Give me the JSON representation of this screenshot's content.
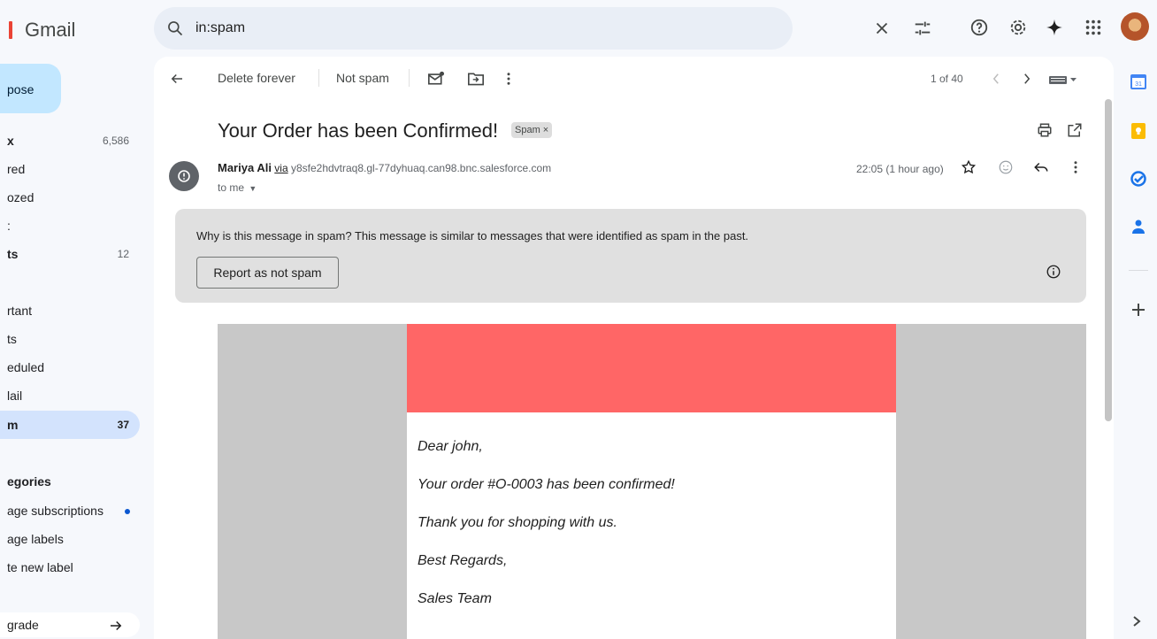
{
  "app": {
    "name": "Gmail"
  },
  "search": {
    "query": "in:spam"
  },
  "sidebar": {
    "compose_label": "pose",
    "items": [
      {
        "label": "x",
        "count": "6,586"
      },
      {
        "label": "red",
        "count": ""
      },
      {
        "label": "ozed",
        "count": ""
      },
      {
        "label": ":",
        "count": ""
      },
      {
        "label": "ts",
        "count": "12"
      },
      {
        "label": "",
        "count": ""
      },
      {
        "label": "rtant",
        "count": ""
      },
      {
        "label": "ts",
        "count": ""
      },
      {
        "label": "eduled",
        "count": ""
      },
      {
        "label": "lail",
        "count": ""
      },
      {
        "label": "m",
        "count": "37"
      }
    ],
    "categories_label": "egories",
    "category_items": [
      {
        "label": "age subscriptions"
      },
      {
        "label": "age labels"
      },
      {
        "label": "te new label"
      }
    ],
    "upgrade_label": "grade"
  },
  "toolbar": {
    "delete_forever": "Delete forever",
    "not_spam": "Not spam",
    "pager": "1 of 40"
  },
  "email": {
    "subject": "Your Order has been Confirmed!",
    "label_chip": "Spam ×",
    "sender_name": "Mariya Ali",
    "via": "via",
    "sender_domain": "y8sfe2hdvtraq8.gl-77dyhuaq.can98.bnc.salesforce.com",
    "to": "to me",
    "time": "22:05 (1 hour ago)",
    "spam_why_title": "Why is this message in spam?",
    "spam_why_text": " This message is similar to messages that were identified as spam in the past.",
    "report_button": "Report as not spam",
    "body_lines": [
      "Dear john,",
      "Your order #O-0003 has been confirmed!",
      "Thank you for shopping with us.",
      "Best Regards,",
      "Sales Team"
    ],
    "header_color": "#ff6666"
  },
  "colors": {
    "accent": "#0b57d0",
    "active_nav": "#d3e3fd",
    "compose": "#c2e7ff"
  }
}
